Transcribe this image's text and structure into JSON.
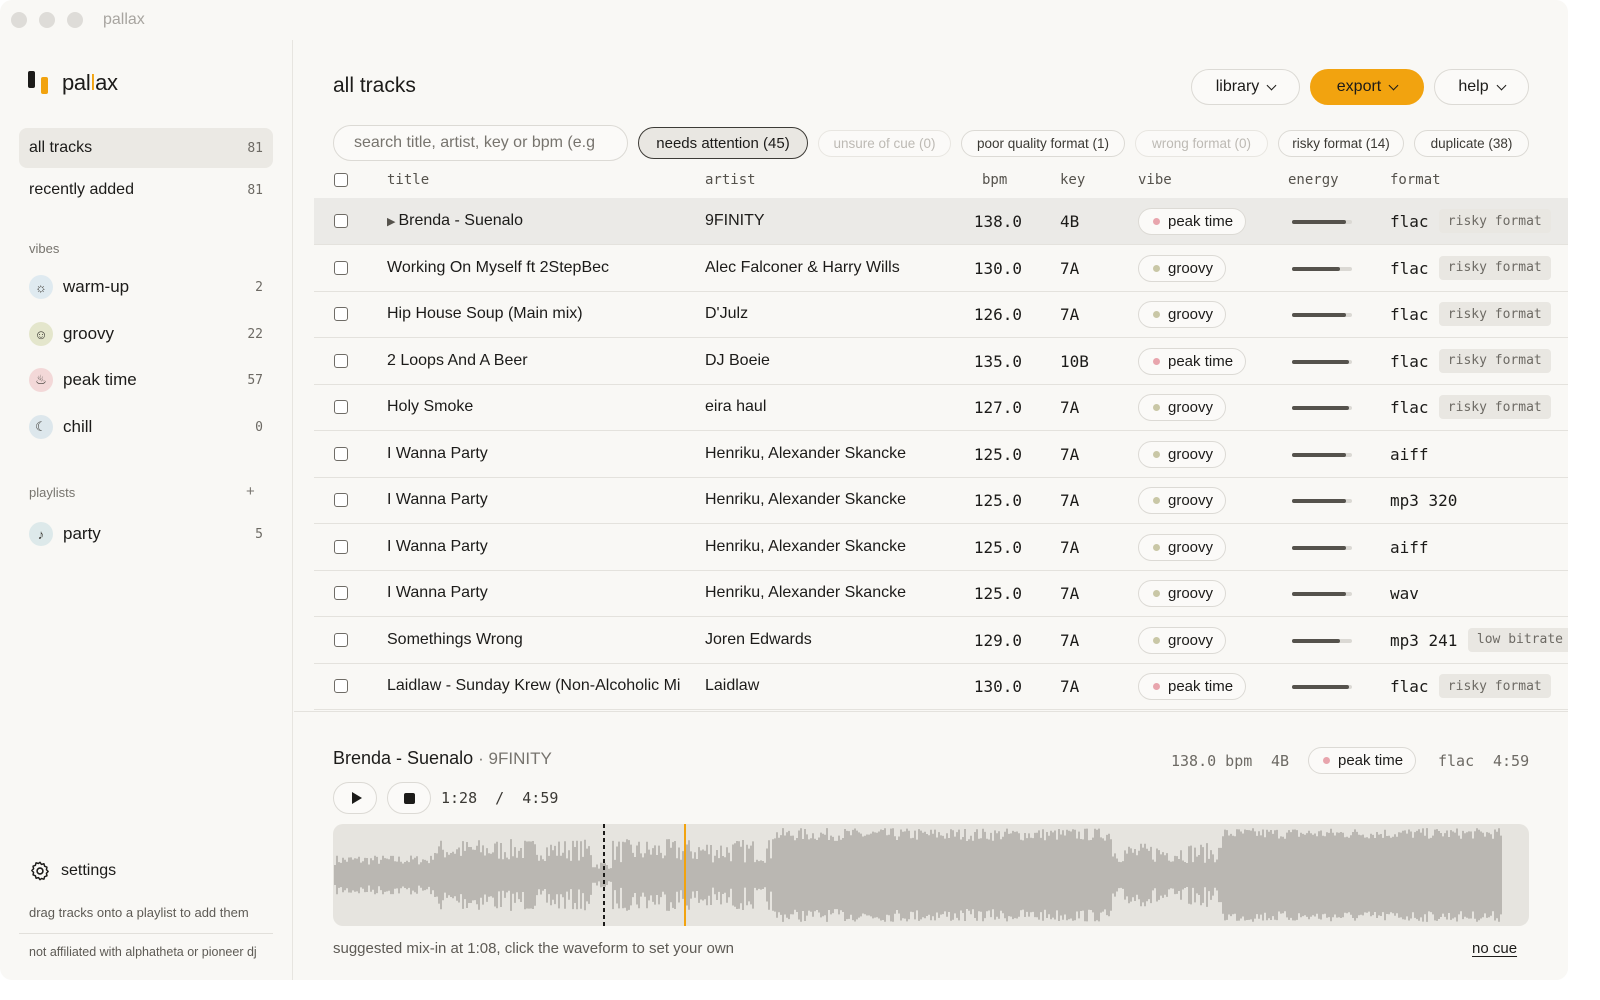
{
  "window": {
    "title": "pallax"
  },
  "brand": {
    "name_prefix": "pal",
    "name_highlight": "l",
    "name_suffix": "ax"
  },
  "sidebar": {
    "nav": [
      {
        "label": "all tracks",
        "count": "81",
        "active": true
      },
      {
        "label": "recently added",
        "count": "81",
        "active": false
      }
    ],
    "vibes_label": "vibes",
    "vibes": [
      {
        "label": "warm-up",
        "count": "2",
        "icon": "sun-icon",
        "glyph": "☼",
        "color": "#dfeaf0"
      },
      {
        "label": "groovy",
        "count": "22",
        "icon": "smile-icon",
        "glyph": "☺",
        "color": "#e4e6cc"
      },
      {
        "label": "peak time",
        "count": "57",
        "icon": "flame-icon",
        "glyph": "♨",
        "color": "#f3d8d8"
      },
      {
        "label": "chill",
        "count": "0",
        "icon": "moon-icon",
        "glyph": "☾",
        "color": "#dde7ec"
      }
    ],
    "playlists_label": "playlists",
    "add_playlist": "+",
    "playlists": [
      {
        "label": "party",
        "count": "5",
        "icon": "bell-icon",
        "glyph": "♪",
        "color": "#dde9ea"
      }
    ],
    "settings_label": "settings",
    "hint": "drag tracks onto a playlist to add them",
    "disclaimer": "not affiliated with alphatheta or pioneer dj"
  },
  "header": {
    "title": "all tracks",
    "library": "library",
    "export": "export",
    "help": "help"
  },
  "search": {
    "placeholder": "search title, artist, key or bpm (e.g"
  },
  "filters": [
    {
      "label": "needs attention (45)",
      "state": "active"
    },
    {
      "label": "unsure of cue (0)",
      "state": "disabled"
    },
    {
      "label": "poor quality format (1)",
      "state": "normal"
    },
    {
      "label": "wrong format (0)",
      "state": "disabled"
    },
    {
      "label": "risky format (14)",
      "state": "normal"
    },
    {
      "label": "duplicate (38)",
      "state": "normal"
    }
  ],
  "columns": {
    "title": "title",
    "artist": "artist",
    "bpm": "bpm",
    "key": "key",
    "vibe": "vibe",
    "energy": "energy",
    "format": "format"
  },
  "vibe_colors": {
    "peak time": "#e8a5ad",
    "groovy": "#c9c7a6"
  },
  "tracks": [
    {
      "title": "Brenda - Suenalo",
      "artist": "9FINITY",
      "bpm": "138.0",
      "key": "4B",
      "vibe": "peak time",
      "energy": 0.9,
      "format": "flac",
      "flag": "risky format",
      "selected": true,
      "playing": true
    },
    {
      "title": "Working On Myself ft 2StepBec",
      "artist": "Alec Falconer & Harry Wills",
      "bpm": "130.0",
      "key": "7A",
      "vibe": "groovy",
      "energy": 0.8,
      "format": "flac",
      "flag": "risky format"
    },
    {
      "title": "Hip House Soup (Main mix)",
      "artist": "D'Julz",
      "bpm": "126.0",
      "key": "7A",
      "vibe": "groovy",
      "energy": 0.9,
      "format": "flac",
      "flag": "risky format"
    },
    {
      "title": "2 Loops And A Beer",
      "artist": "DJ Boeie",
      "bpm": "135.0",
      "key": "10B",
      "vibe": "peak time",
      "energy": 0.95,
      "format": "flac",
      "flag": "risky format"
    },
    {
      "title": "Holy Smoke",
      "artist": "eira haul",
      "bpm": "127.0",
      "key": "7A",
      "vibe": "groovy",
      "energy": 0.95,
      "format": "flac",
      "flag": "risky format"
    },
    {
      "title": "I Wanna Party",
      "artist": "Henriku, Alexander Skancke",
      "bpm": "125.0",
      "key": "7A",
      "vibe": "groovy",
      "energy": 0.9,
      "format": "aiff",
      "flag": ""
    },
    {
      "title": "I Wanna Party",
      "artist": "Henriku, Alexander Skancke",
      "bpm": "125.0",
      "key": "7A",
      "vibe": "groovy",
      "energy": 0.9,
      "format": "mp3 320",
      "flag": ""
    },
    {
      "title": "I Wanna Party",
      "artist": "Henriku, Alexander Skancke",
      "bpm": "125.0",
      "key": "7A",
      "vibe": "groovy",
      "energy": 0.9,
      "format": "aiff",
      "flag": ""
    },
    {
      "title": "I Wanna Party",
      "artist": "Henriku, Alexander Skancke",
      "bpm": "125.0",
      "key": "7A",
      "vibe": "groovy",
      "energy": 0.9,
      "format": "wav",
      "flag": ""
    },
    {
      "title": "Somethings Wrong",
      "artist": "Joren Edwards",
      "bpm": "129.0",
      "key": "7A",
      "vibe": "groovy",
      "energy": 0.8,
      "format": "mp3 241",
      "flag": "low bitrate"
    },
    {
      "title": "Laidlaw - Sunday Krew (Non-Alcoholic Mi",
      "artist": "Laidlaw",
      "bpm": "130.0",
      "key": "7A",
      "vibe": "peak time",
      "energy": 0.95,
      "format": "flac",
      "flag": "risky format"
    }
  ],
  "player": {
    "title": "Brenda - Suenalo",
    "artist": "· 9FINITY",
    "bpm": "138.0 bpm",
    "key": "4B",
    "vibe": "peak time",
    "format": "flac",
    "duration": "4:59",
    "time": "1:28  /  4:59",
    "playhead_fraction": 0.294,
    "cue_fraction": 0.227,
    "hint": "suggested mix-in at 1:08, click the waveform to set your own",
    "no_cue": "no cue",
    "accent": "#f2a30f"
  }
}
